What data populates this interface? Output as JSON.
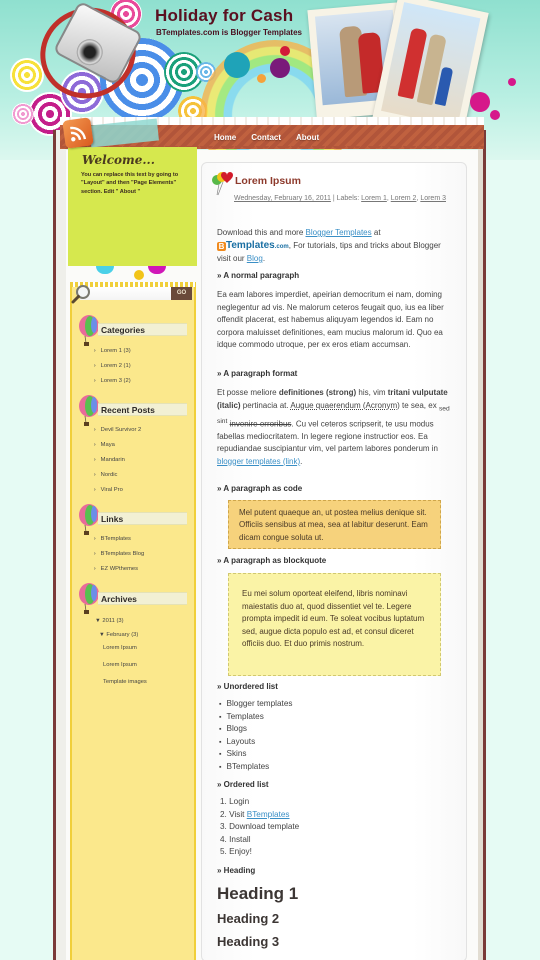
{
  "site": {
    "title": "Holiday for Cash",
    "subtitle": "BTemplates.com is Blogger Templates"
  },
  "nav": {
    "items": [
      {
        "label": "Home"
      },
      {
        "label": "Contact"
      },
      {
        "label": "About"
      }
    ]
  },
  "welcome": {
    "title": "Welcome...",
    "text": "You can replace this text by going to \"Layout\" and then \"Page Elements\" section. Edit \" About \""
  },
  "search": {
    "placeholder": "",
    "button_label": "GO"
  },
  "sidebar": {
    "categories": {
      "title": "Categories",
      "items": [
        "Lorem 1 (3)",
        "Lorem 2 (1)",
        "Lorem 3 (2)"
      ]
    },
    "recent_posts": {
      "title": "Recent Posts",
      "items": [
        "Devil Survivor 2",
        "Maya",
        "Mandarin",
        "Nordic",
        "Viral Pro"
      ]
    },
    "links": {
      "title": "Links",
      "items": [
        "BTemplates",
        "BTemplates Blog",
        "EZ WPthemes"
      ]
    },
    "archives": {
      "title": "Archives",
      "year": "2011",
      "year_count": "(3)",
      "month": "February",
      "month_count": "(3)",
      "posts": [
        "Lorem Ipsum",
        "Lorem Ipsum",
        "Template images"
      ]
    }
  },
  "post": {
    "title": "Lorem Ipsum",
    "date": "Wednesday, February 16, 2011",
    "labels_prefix": "| Labels:",
    "labels": [
      "Lorem 1",
      "Lorem 2",
      "Lorem 3"
    ],
    "intro": {
      "text1": "Download this and more",
      "link1": "Blogger Templates",
      "text2": "at",
      "logo_text": "Templates",
      "logo_suffix": ".com",
      "text3": ", For tutorials, tips and tricks about Blogger visit our",
      "link2": "Blog",
      "text4": "."
    },
    "sections": {
      "normal": "» A normal paragraph",
      "format": "» A paragraph format",
      "code": "» A paragraph as code",
      "blockquote": "» A paragraph as blockquote",
      "unordered": "» Unordered list",
      "ordered": "» Ordered list",
      "heading": "» Heading"
    },
    "normal_paragraph": "Ea eam labores imperdiet, apeirian democritum ei nam, doming neglegentur ad vis. Ne malorum ceteros feugait quo, ius ea liber offendit placerat, est habemus aliquyam legendos id. Eam no corpora maluisset definitiones, eam mucius malorum id. Quo ea idque commodo utroque, per ex eros etiam accumsan.",
    "format_paragraph": {
      "t1": "Et posse meliore",
      "strong": "definitiones (strong)",
      "t2": "his, vim",
      "italic": "tritani vulputate (italic)",
      "t3": "pertinacia at.",
      "acronym": "Augue quaerendum (Acronym)",
      "t4": "te sea, ex",
      "sub": "sed",
      "sup": "sint",
      "strike": "invenire erroribus",
      "t5": ". Cu vel ceteros scripserit, te usu modus fabellas mediocritatem. In legere regione instructior eos. Ea repudiandae suscipiantur vim, vel partem labores ponderum in",
      "link": "blogger templates (link)",
      "t6": "."
    },
    "code_paragraph": "Mel putent quaeque an, ut postea melius denique sit. Officiis sensibus at mea, sea at labitur deserunt. Eam dicam congue soluta ut.",
    "blockquote_paragraph": "Eu mei solum oporteat eleifend, libris nominavi maiestatis duo at, quod dissentiet vel te. Legere prompta impedit id eum. Te soleat vocibus luptatum sed, augue dicta populo est ad, et consul diceret officiis duo. Et duo primis nostrum.",
    "unordered_list": [
      "Blogger templates",
      "Templates",
      "Blogs",
      "Layouts",
      "Skins",
      "BTemplates"
    ],
    "ordered_list": [
      {
        "num": "1.",
        "text": "Login",
        "link": ""
      },
      {
        "num": "2.",
        "text": "Visit",
        "link": "BTemplates"
      },
      {
        "num": "3.",
        "text": "Download template",
        "link": ""
      },
      {
        "num": "4.",
        "text": "Install",
        "link": ""
      },
      {
        "num": "5.",
        "text": "Enjoy!",
        "link": ""
      }
    ],
    "headings": [
      "Heading 1",
      "Heading 2",
      "Heading 3"
    ]
  },
  "colors": {
    "page_bg": "#e6fbf4",
    "nav_bar": "#b1553a",
    "post_title": "#8d3a2c",
    "link": "#3a8fc6",
    "sidebar_bg": "#fbe88c",
    "welcome_bg": "#d6e84e",
    "code_bg": "#f6d27c",
    "quote_bg": "#faf3a6"
  }
}
